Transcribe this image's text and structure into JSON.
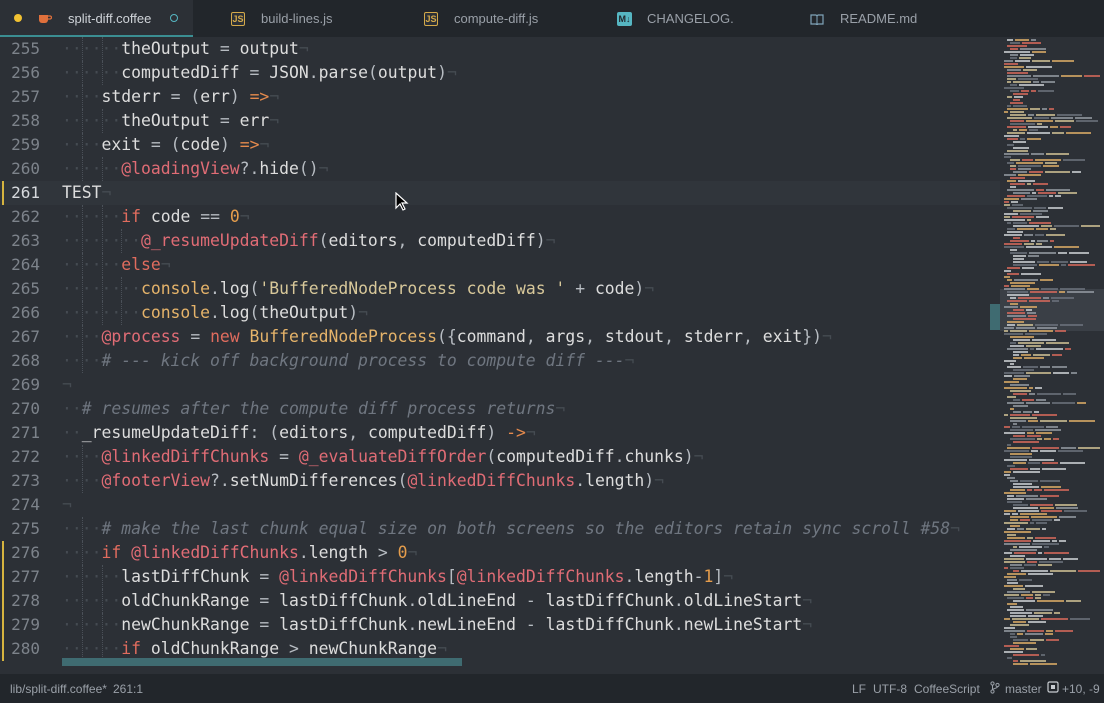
{
  "tabs": [
    {
      "label": "split-diff.coffee",
      "icon": "coffee-icon",
      "active": true,
      "modified": true
    },
    {
      "label": "build-lines.js",
      "icon": "js-icon"
    },
    {
      "label": "compute-diff.js",
      "icon": "js-icon"
    },
    {
      "label": "CHANGELOG.md",
      "icon": "markdown-icon"
    },
    {
      "label": "README.md",
      "icon": "book-icon"
    }
  ],
  "editor": {
    "lines": [
      {
        "n": "255",
        "code": "theOutput = output"
      },
      {
        "n": "256",
        "code": "computedDiff = JSON.parse(output)"
      },
      {
        "n": "257",
        "code": "stderr = (err) =>"
      },
      {
        "n": "258",
        "code": "theOutput = err"
      },
      {
        "n": "259",
        "code": "exit = (code) =>"
      },
      {
        "n": "260",
        "code": "@loadingView?.hide()"
      },
      {
        "n": "261",
        "code": "TEST"
      },
      {
        "n": "262",
        "code": "if code == 0"
      },
      {
        "n": "263",
        "code": "@_resumeUpdateDiff(editors, computedDiff)"
      },
      {
        "n": "264",
        "code": "else"
      },
      {
        "n": "265",
        "code": "console.log('BufferedNodeProcess code was ' + code)"
      },
      {
        "n": "266",
        "code": "console.log(theOutput)"
      },
      {
        "n": "267",
        "code": "@process = new BufferedNodeProcess({command, args, stdout, stderr, exit})"
      },
      {
        "n": "268",
        "code": "# --- kick off background process to compute diff ---"
      },
      {
        "n": "269",
        "code": ""
      },
      {
        "n": "270",
        "code": "# resumes after the compute diff process returns"
      },
      {
        "n": "271",
        "code": "_resumeUpdateDiff: (editors, computedDiff) ->"
      },
      {
        "n": "272",
        "code": "@linkedDiffChunks = @_evaluateDiffOrder(computedDiff.chunks)"
      },
      {
        "n": "273",
        "code": "@footerView?.setNumDifferences(@linkedDiffChunks.length)"
      },
      {
        "n": "274",
        "code": ""
      },
      {
        "n": "275",
        "code": "# make the last chunk equal size on both screens so the editors retain sync scroll #58"
      },
      {
        "n": "276",
        "code": "if @linkedDiffChunks.length > 0"
      },
      {
        "n": "277",
        "code": "lastDiffChunk = @linkedDiffChunks[@linkedDiffChunks.length-1]"
      },
      {
        "n": "278",
        "code": "oldChunkRange = lastDiffChunk.oldLineEnd - lastDiffChunk.oldLineStart"
      },
      {
        "n": "279",
        "code": "newChunkRange = lastDiffChunk.newLineEnd - lastDiffChunk.newLineStart"
      },
      {
        "n": "280",
        "code": "if oldChunkRange > newChunkRange"
      }
    ]
  },
  "status": {
    "file": "lib/split-diff.coffee*",
    "position": "261:1",
    "line_ending": "LF",
    "encoding": "UTF-8",
    "grammar": "CoffeeScript",
    "branch": "master",
    "diff": "+10, -9"
  },
  "colors": {
    "accent": "#3b8e92",
    "modified": "#f2c232"
  }
}
